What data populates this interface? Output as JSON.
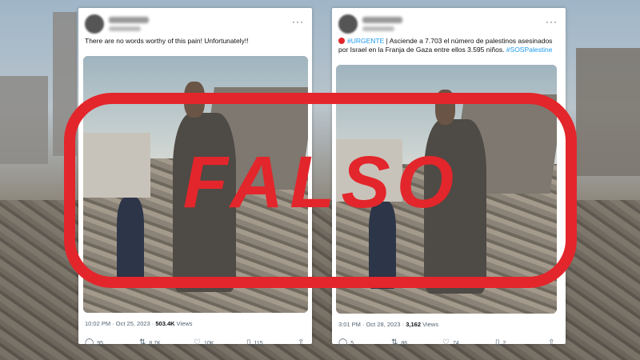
{
  "tweets": [
    {
      "text": "There are no words worthy of this pain! Unfortunately!!",
      "meta_time": "10:02 PM · Oct 25, 2023 · ",
      "meta_views": "503.4K",
      "meta_views_label": " Views",
      "replies": "95",
      "reposts": "8.7K",
      "likes": "10K",
      "bookmarks": "115"
    },
    {
      "text_tag1": "#URGENTE",
      "text_body": " | Asciende a 7.703 el número de palestinos asesinados por Israel en la Franja de Gaza entre ellos 3.595 niños. ",
      "text_tag2": "#SOSPalestine",
      "meta_time": "3:01 PM · Oct 28, 2023 · ",
      "meta_views": "3,162",
      "meta_views_label": " Views",
      "replies": "5",
      "reposts": "86",
      "likes": "74",
      "bookmarks": "2"
    }
  ],
  "stamp": {
    "label": "FALSO",
    "color": "#e3262b"
  },
  "icons": {
    "more": "more-icon",
    "reply": "reply-icon",
    "repost": "repost-icon",
    "like": "heart-icon",
    "bookmark": "bookmark-icon",
    "share": "share-icon"
  },
  "colors": {
    "link": "#1d9bf0",
    "text_secondary": "#536471"
  }
}
